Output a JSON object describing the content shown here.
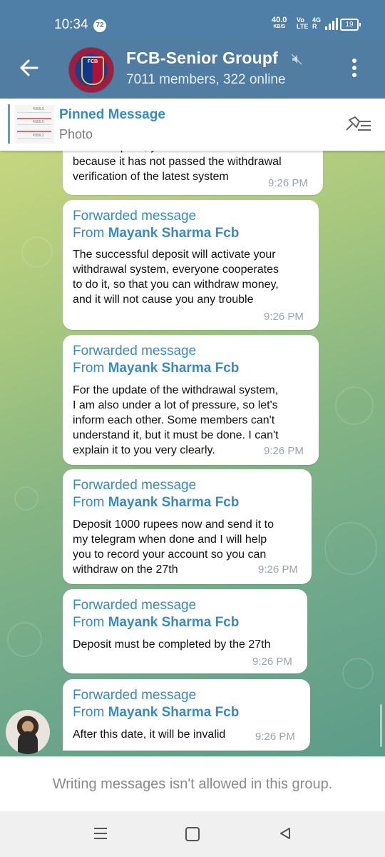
{
  "status_bar": {
    "time": "10:34",
    "notification_count": "72",
    "speed_value": "40.0",
    "speed_unit": "KB/S",
    "volte_top": "Vo",
    "volte_bottom": "LTE",
    "net_top": "4G",
    "net_bottom": "R",
    "battery": "19"
  },
  "header": {
    "title": "FCB-Senior Groupf",
    "subtitle": "7011 members, 322 online",
    "avatar_text": "FCB"
  },
  "pinned": {
    "title": "Pinned Message",
    "subtitle": "Photo",
    "thumb_values": [
      "₹999.0",
      "₹955.5",
      "₹999.2"
    ]
  },
  "messages": [
    {
      "text": "do not deposit, your withdrawal will fail\nbecause it has not passed the withdrawal\nverification of the latest system",
      "time": "9:26 PM"
    },
    {
      "forward_label": "Forwarded message",
      "from_prefix": "From ",
      "from_name": "Mayank Sharma Fcb",
      "text": "The successful deposit will activate your\nwithdrawal system, everyone cooperates\nto do it, so that you can withdraw money,\nand it will not cause you any trouble",
      "time": "9:26 PM"
    },
    {
      "forward_label": "Forwarded message",
      "from_prefix": "From ",
      "from_name": "Mayank Sharma Fcb",
      "text": "For the update of the withdrawal system,\nI am also under a lot of pressure, so let's\ninform each other. Some members can't\nunderstand it, but it must be done. I can't\nexplain it to you very clearly.",
      "time": "9:26 PM"
    },
    {
      "forward_label": "Forwarded message",
      "from_prefix": "From ",
      "from_name": "Mayank Sharma Fcb",
      "text": "Deposit 1000 rupees now and send it to\nmy telegram when done and I will help\nyou to record your account so you can\nwithdraw on the 27th",
      "time": "9:26 PM"
    },
    {
      "forward_label": "Forwarded message",
      "from_prefix": "From ",
      "from_name": "Mayank Sharma Fcb",
      "text": "Deposit must be completed by the 27th",
      "time": "9:26 PM"
    },
    {
      "forward_label": "Forwarded message",
      "from_prefix": "From ",
      "from_name": "Mayank Sharma Fcb",
      "text": "After this date, it will be invalid",
      "time": "9:26 PM"
    }
  ],
  "composer": {
    "notice": "Writing messages isn't allowed in this group."
  },
  "icons": {
    "back": "arrow-left-icon",
    "mute": "muted-speaker-icon",
    "menu": "more-vertical-icon",
    "unpin": "unpin-list-icon",
    "nav_recents": "recents-icon",
    "nav_home": "home-icon",
    "nav_back": "back-triangle-icon"
  },
  "colors": {
    "header": "#517da2",
    "statusbar": "#4f7fa6",
    "accent_blue": "#3a8ac4"
  }
}
